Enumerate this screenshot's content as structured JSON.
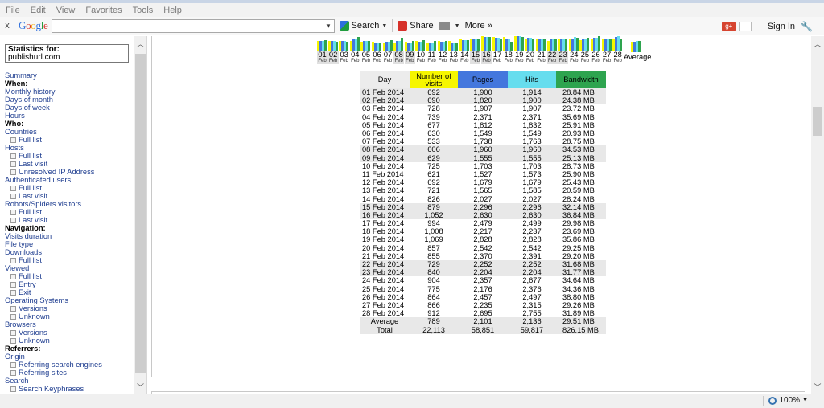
{
  "menu": [
    "File",
    "Edit",
    "View",
    "Favorites",
    "Tools",
    "Help"
  ],
  "toolbar": {
    "close_label": "x",
    "logo_text": "Google",
    "search_label": "Search",
    "share_label": "Share",
    "more_label": "More »",
    "signin_label": "Sign In",
    "gplus_label": "g+"
  },
  "sidebar": {
    "stats_title": "Statistics for:",
    "stats_site": "publishurl.com",
    "items": [
      {
        "text": "Summary",
        "kind": "link"
      },
      {
        "text": "When:",
        "kind": "head"
      },
      {
        "text": "Monthly history",
        "kind": "link"
      },
      {
        "text": "Days of month",
        "kind": "link"
      },
      {
        "text": "Days of week",
        "kind": "link"
      },
      {
        "text": "Hours",
        "kind": "link"
      },
      {
        "text": "Who:",
        "kind": "head"
      },
      {
        "text": "Countries",
        "kind": "link"
      },
      {
        "text": "Full list",
        "kind": "sub"
      },
      {
        "text": "Hosts",
        "kind": "link"
      },
      {
        "text": "Full list",
        "kind": "sub"
      },
      {
        "text": "Last visit",
        "kind": "sub"
      },
      {
        "text": "Unresolved IP Address",
        "kind": "sub"
      },
      {
        "text": "Authenticated users",
        "kind": "link"
      },
      {
        "text": "Full list",
        "kind": "sub"
      },
      {
        "text": "Last visit",
        "kind": "sub"
      },
      {
        "text": "Robots/Spiders visitors",
        "kind": "link"
      },
      {
        "text": "Full list",
        "kind": "sub"
      },
      {
        "text": "Last visit",
        "kind": "sub"
      },
      {
        "text": "Navigation:",
        "kind": "head"
      },
      {
        "text": "Visits duration",
        "kind": "link"
      },
      {
        "text": "File type",
        "kind": "link"
      },
      {
        "text": "Downloads",
        "kind": "link"
      },
      {
        "text": "Full list",
        "kind": "sub"
      },
      {
        "text": "Viewed",
        "kind": "link"
      },
      {
        "text": "Full list",
        "kind": "sub"
      },
      {
        "text": "Entry",
        "kind": "sub"
      },
      {
        "text": "Exit",
        "kind": "sub"
      },
      {
        "text": "Operating Systems",
        "kind": "link"
      },
      {
        "text": "Versions",
        "kind": "sub"
      },
      {
        "text": "Unknown",
        "kind": "sub"
      },
      {
        "text": "Browsers",
        "kind": "link"
      },
      {
        "text": "Versions",
        "kind": "sub"
      },
      {
        "text": "Unknown",
        "kind": "sub"
      },
      {
        "text": "Referrers:",
        "kind": "head"
      },
      {
        "text": "Origin",
        "kind": "link"
      },
      {
        "text": "Referring search engines",
        "kind": "sub"
      },
      {
        "text": "Referring sites",
        "kind": "sub"
      },
      {
        "text": "Search",
        "kind": "link"
      },
      {
        "text": "Search Keyphrases",
        "kind": "sub"
      }
    ]
  },
  "day_axis": {
    "days": [
      "01",
      "02",
      "03",
      "04",
      "05",
      "06",
      "07",
      "08",
      "09",
      "10",
      "11",
      "12",
      "13",
      "14",
      "15",
      "16",
      "17",
      "18",
      "19",
      "20",
      "21",
      "22",
      "23",
      "24",
      "25",
      "26",
      "27",
      "28"
    ],
    "month_label": "Feb",
    "weekend_days": [
      "01",
      "02",
      "08",
      "09",
      "15",
      "16",
      "22",
      "23"
    ],
    "average_label": "Average"
  },
  "table": {
    "headers": {
      "day": "Day",
      "visits": "Number of visits",
      "pages": "Pages",
      "hits": "Hits",
      "bandwidth": "Bandwidth"
    },
    "header_colors": {
      "day": "#ececec",
      "visits": "#f6f600",
      "pages": "#4477dd",
      "hits": "#66ddee",
      "bandwidth": "#2ea44f"
    },
    "rows": [
      {
        "day": "01 Feb 2014",
        "visits": "692",
        "pages": "1,900",
        "hits": "1,914",
        "bw": "28.84 MB",
        "weekend": true
      },
      {
        "day": "02 Feb 2014",
        "visits": "690",
        "pages": "1,820",
        "hits": "1,900",
        "bw": "24.38 MB",
        "weekend": true
      },
      {
        "day": "03 Feb 2014",
        "visits": "728",
        "pages": "1,907",
        "hits": "1,907",
        "bw": "23.72 MB",
        "weekend": false
      },
      {
        "day": "04 Feb 2014",
        "visits": "739",
        "pages": "2,371",
        "hits": "2,371",
        "bw": "35.69 MB",
        "weekend": false
      },
      {
        "day": "05 Feb 2014",
        "visits": "677",
        "pages": "1,812",
        "hits": "1,832",
        "bw": "25.91 MB",
        "weekend": false
      },
      {
        "day": "06 Feb 2014",
        "visits": "630",
        "pages": "1,549",
        "hits": "1,549",
        "bw": "20.93 MB",
        "weekend": false
      },
      {
        "day": "07 Feb 2014",
        "visits": "533",
        "pages": "1,738",
        "hits": "1,763",
        "bw": "28.75 MB",
        "weekend": false
      },
      {
        "day": "08 Feb 2014",
        "visits": "606",
        "pages": "1,960",
        "hits": "1,960",
        "bw": "34.53 MB",
        "weekend": true
      },
      {
        "day": "09 Feb 2014",
        "visits": "629",
        "pages": "1,555",
        "hits": "1,555",
        "bw": "25.13 MB",
        "weekend": true
      },
      {
        "day": "10 Feb 2014",
        "visits": "725",
        "pages": "1,703",
        "hits": "1,703",
        "bw": "28.73 MB",
        "weekend": false
      },
      {
        "day": "11 Feb 2014",
        "visits": "621",
        "pages": "1,527",
        "hits": "1,573",
        "bw": "25.90 MB",
        "weekend": false
      },
      {
        "day": "12 Feb 2014",
        "visits": "692",
        "pages": "1,679",
        "hits": "1,679",
        "bw": "25.43 MB",
        "weekend": false
      },
      {
        "day": "13 Feb 2014",
        "visits": "721",
        "pages": "1,565",
        "hits": "1,585",
        "bw": "20.59 MB",
        "weekend": false
      },
      {
        "day": "14 Feb 2014",
        "visits": "826",
        "pages": "2,027",
        "hits": "2,027",
        "bw": "28.24 MB",
        "weekend": false
      },
      {
        "day": "15 Feb 2014",
        "visits": "879",
        "pages": "2,296",
        "hits": "2,296",
        "bw": "32.14 MB",
        "weekend": true
      },
      {
        "day": "16 Feb 2014",
        "visits": "1,052",
        "pages": "2,630",
        "hits": "2,630",
        "bw": "36.84 MB",
        "weekend": true
      },
      {
        "day": "17 Feb 2014",
        "visits": "994",
        "pages": "2,479",
        "hits": "2,499",
        "bw": "29.98 MB",
        "weekend": false
      },
      {
        "day": "18 Feb 2014",
        "visits": "1,008",
        "pages": "2,217",
        "hits": "2,237",
        "bw": "23.69 MB",
        "weekend": false
      },
      {
        "day": "19 Feb 2014",
        "visits": "1,069",
        "pages": "2,828",
        "hits": "2,828",
        "bw": "35.86 MB",
        "weekend": false
      },
      {
        "day": "20 Feb 2014",
        "visits": "857",
        "pages": "2,542",
        "hits": "2,542",
        "bw": "29.25 MB",
        "weekend": false
      },
      {
        "day": "21 Feb 2014",
        "visits": "855",
        "pages": "2,370",
        "hits": "2,391",
        "bw": "29.20 MB",
        "weekend": false
      },
      {
        "day": "22 Feb 2014",
        "visits": "729",
        "pages": "2,252",
        "hits": "2,252",
        "bw": "31.68 MB",
        "weekend": true
      },
      {
        "day": "23 Feb 2014",
        "visits": "840",
        "pages": "2,204",
        "hits": "2,204",
        "bw": "31.77 MB",
        "weekend": true
      },
      {
        "day": "24 Feb 2014",
        "visits": "904",
        "pages": "2,357",
        "hits": "2,677",
        "bw": "34.64 MB",
        "weekend": false
      },
      {
        "day": "25 Feb 2014",
        "visits": "775",
        "pages": "2,176",
        "hits": "2,376",
        "bw": "34.36 MB",
        "weekend": false
      },
      {
        "day": "26 Feb 2014",
        "visits": "864",
        "pages": "2,457",
        "hits": "2,497",
        "bw": "38.80 MB",
        "weekend": false
      },
      {
        "day": "27 Feb 2014",
        "visits": "866",
        "pages": "2,235",
        "hits": "2,315",
        "bw": "29.26 MB",
        "weekend": false
      },
      {
        "day": "28 Feb 2014",
        "visits": "912",
        "pages": "2,695",
        "hits": "2,755",
        "bw": "31.89 MB",
        "weekend": false
      }
    ],
    "average": {
      "day": "Average",
      "visits": "789",
      "pages": "2,101",
      "hits": "2,136",
      "bw": "29.51 MB"
    },
    "total": {
      "day": "Total",
      "visits": "22,113",
      "pages": "58,851",
      "hits": "59,817",
      "bw": "826.15 MB"
    }
  },
  "status": {
    "zoom": "100%"
  }
}
